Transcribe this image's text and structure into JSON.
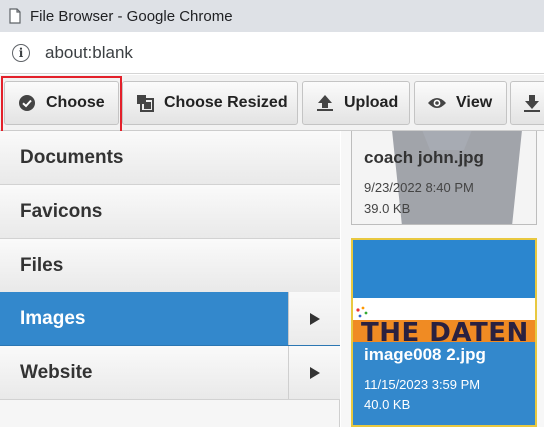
{
  "window": {
    "title": "File Browser - Google Chrome"
  },
  "address": {
    "url": "about:blank"
  },
  "toolbar": {
    "choose_label": "Choose",
    "choose_resized_label": "Choose Resized",
    "upload_label": "Upload",
    "view_label": "View"
  },
  "folders": [
    {
      "label": "Documents",
      "has_children": false,
      "selected": false
    },
    {
      "label": "Favicons",
      "has_children": false,
      "selected": false
    },
    {
      "label": "Files",
      "has_children": false,
      "selected": false
    },
    {
      "label": "Images",
      "has_children": true,
      "selected": true
    },
    {
      "label": "Website",
      "has_children": true,
      "selected": false
    }
  ],
  "files": [
    {
      "name": "coach john.jpg",
      "date": "9/23/2022 8:40 PM",
      "size": "39.0 KB",
      "selected": false
    },
    {
      "name": "image008 2.jpg",
      "date": "11/15/2023 3:59 PM",
      "size": "40.0 KB",
      "selected": true,
      "thumbnail_text": "THE DATEN"
    }
  ],
  "colors": {
    "accent": "#3388cc",
    "highlight_border": "#e3202a",
    "selected_card_border": "#e8c840"
  }
}
